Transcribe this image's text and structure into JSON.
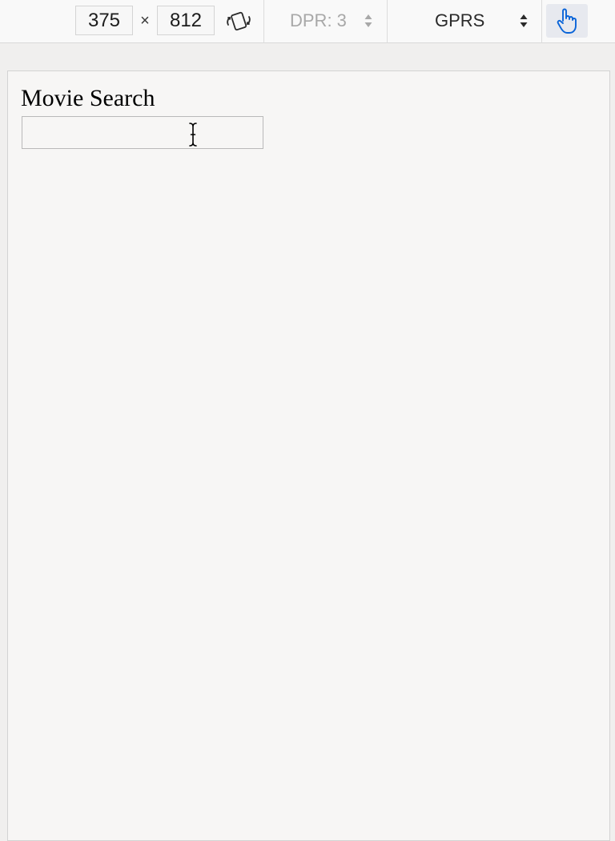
{
  "toolbar": {
    "width_value": "375",
    "times_symbol": "×",
    "height_value": "812",
    "dpr_label": "DPR: 3",
    "network_label": "GPRS"
  },
  "page": {
    "title": "Movie Search",
    "search_value": "",
    "search_placeholder": ""
  },
  "icons": {
    "rotate": "rotate-device-icon",
    "touch": "touch-simulation-hand-icon",
    "dpr_arrows": "select-updown-arrows-icon",
    "network_arrows": "select-updown-arrows-icon",
    "cursor": "text-ibeam-cursor-icon"
  },
  "colors": {
    "touch_active": "#0a64d8",
    "toolbar_bg": "#f9f9f9",
    "viewport_bg": "#f7f6f5"
  }
}
